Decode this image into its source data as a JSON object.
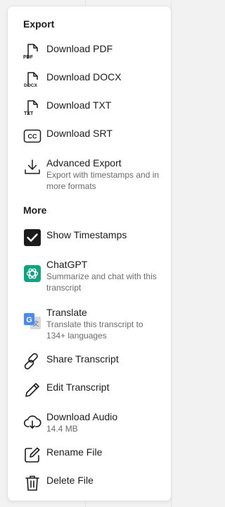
{
  "sections": {
    "export_title": "Export",
    "more_title": "More"
  },
  "items": {
    "download_pdf": {
      "label": "Download PDF",
      "badge": "PDF"
    },
    "download_docx": {
      "label": "Download DOCX",
      "badge": "DOCX"
    },
    "download_txt": {
      "label": "Download TXT",
      "badge": "TXT"
    },
    "download_srt": {
      "label": "Download SRT",
      "badge": "CC"
    },
    "advanced_export": {
      "label": "Advanced Export",
      "desc": "Export with timestamps and in more formats"
    },
    "show_timestamps": {
      "label": "Show Timestamps",
      "checked": true
    },
    "chatgpt": {
      "label": "ChatGPT",
      "desc": "Summarize and chat with this transcript"
    },
    "translate": {
      "label": "Translate",
      "desc": "Translate this transcript to 134+ languages"
    },
    "share_transcript": {
      "label": "Share Transcript"
    },
    "edit_transcript": {
      "label": "Edit Transcript"
    },
    "download_audio": {
      "label": "Download Audio",
      "desc": "14.4 MB"
    },
    "rename_file": {
      "label": "Rename File"
    },
    "delete_file": {
      "label": "Delete File"
    }
  },
  "colors": {
    "chatgpt": "#10a37f",
    "translate_blue": "#4a8af4",
    "checkbox": "#1c1c1c"
  },
  "icons": {
    "download_pdf": "file-pdf-icon",
    "download_docx": "file-docx-icon",
    "download_txt": "file-txt-icon",
    "download_srt": "closed-captions-icon",
    "advanced_export": "download-icon",
    "show_timestamps": "checkbox-checked-icon",
    "chatgpt": "chatgpt-logo-icon",
    "translate": "google-translate-icon",
    "share_transcript": "link-icon",
    "edit_transcript": "pencil-icon",
    "download_audio": "cloud-download-icon",
    "rename_file": "rename-edit-icon",
    "delete_file": "trash-icon"
  }
}
